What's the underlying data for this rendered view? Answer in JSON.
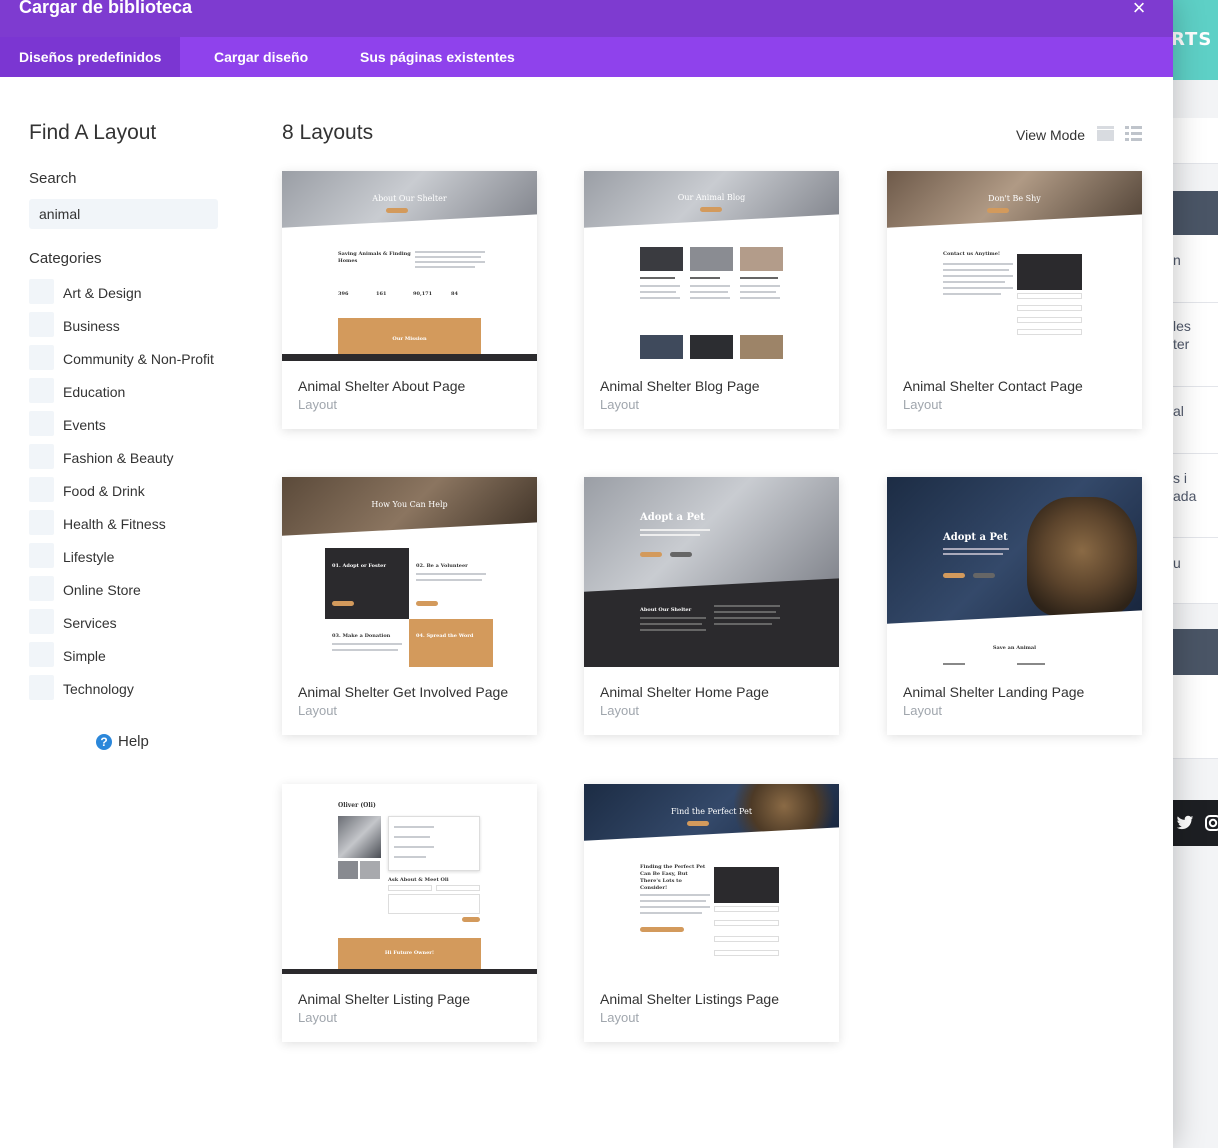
{
  "modal": {
    "title": "Cargar de biblioteca",
    "close_symbol": "×"
  },
  "tabs": [
    {
      "label": "Diseños predefinidos",
      "active": true
    },
    {
      "label": "Cargar diseño",
      "active": false
    },
    {
      "label": "Sus páginas existentes",
      "active": false
    }
  ],
  "sidebar": {
    "title": "Find A Layout",
    "search_label": "Search",
    "search_value": "animal",
    "categories_label": "Categories",
    "categories": [
      "Art & Design",
      "Business",
      "Community & Non-Profit",
      "Education",
      "Events",
      "Fashion & Beauty",
      "Food & Drink",
      "Health & Fitness",
      "Lifestyle",
      "Online Store",
      "Services",
      "Simple",
      "Technology"
    ],
    "help_label": "Help",
    "help_symbol": "?"
  },
  "main": {
    "count_label": "8 Layouts",
    "view_mode_label": "View Mode"
  },
  "layouts": [
    {
      "name": "Animal Shelter About Page",
      "type": "Layout",
      "hero_title": "About Our Shelter",
      "hero_style": "gray",
      "section_title": "Saving Animals & Finding Homes",
      "stats": [
        "396",
        "161",
        "90,171",
        "84"
      ],
      "footer_title": "Our Mission"
    },
    {
      "name": "Animal Shelter Blog Page",
      "type": "Layout",
      "hero_title": "Our Animal Blog",
      "hero_style": "gray"
    },
    {
      "name": "Animal Shelter Contact Page",
      "type": "Layout",
      "hero_title": "Don't Be Shy",
      "hero_style": "warm",
      "section_title": "Contact us Anytime!"
    },
    {
      "name": "Animal Shelter Get Involved Page",
      "type": "Layout",
      "hero_title": "How You Can Help",
      "hero_style": "brown",
      "boxes": [
        "01. Adopt or Foster",
        "02. Be a Volunteer",
        "03. Make a Donation",
        "04. Spread the Word"
      ]
    },
    {
      "name": "Animal Shelter Home Page",
      "type": "Layout",
      "hero_title": "Adopt a Pet",
      "hero_style": "gray",
      "section_title": "About Our Shelter"
    },
    {
      "name": "Animal Shelter Landing Page",
      "type": "Layout",
      "hero_title": "Adopt a Pet",
      "hero_style": "blue",
      "section_title": "Save an Animal"
    },
    {
      "name": "Animal Shelter Listing Page",
      "type": "Layout",
      "hero_title": "Oliver (Oli)",
      "hero_style": "none",
      "section_title": "Ask About & Meet Oli",
      "footer_title": "Hi Future Owner!"
    },
    {
      "name": "Animal Shelter Listings Page",
      "type": "Layout",
      "hero_title": "Find the Perfect Pet",
      "hero_style": "blue",
      "section_title": "Finding the Perfect Pet Can Be Easy, But There's Lots to Consider!"
    }
  ],
  "background_page": {
    "brand_fragment": "RTS",
    "fragments": [
      "n",
      "les",
      "ter",
      "al",
      "s i",
      "ada",
      "u"
    ]
  },
  "colors": {
    "header": "#7e3bd0",
    "tabbar": "#8f42ec",
    "active_tab": "#7b36d2",
    "accent_orange": "#d39a5c",
    "help_blue": "#2b87da"
  }
}
